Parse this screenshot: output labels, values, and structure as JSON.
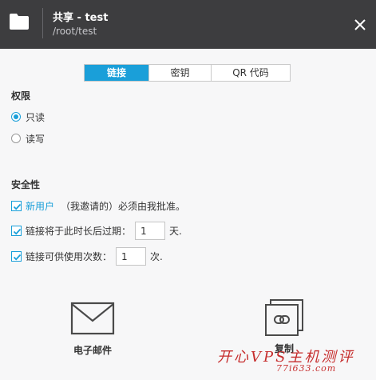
{
  "window": {
    "title": "共享 - test",
    "path": "/root/test",
    "folder_icon": "folder-icon",
    "close_icon": "close-icon"
  },
  "tabs": [
    {
      "label": "链接",
      "active": true
    },
    {
      "label": "密钥",
      "active": false
    },
    {
      "label": "QR 代码",
      "active": false
    }
  ],
  "permissions": {
    "heading": "权限",
    "options": [
      {
        "label": "只读",
        "checked": true
      },
      {
        "label": "读写",
        "checked": false
      }
    ]
  },
  "security": {
    "heading": "安全性",
    "new_user": {
      "link": "新用户",
      "text": "（我邀请的）必须由我批准。",
      "checked": true
    },
    "expire": {
      "text": "链接将于此时长后过期：",
      "value": "1",
      "unit": "天.",
      "checked": true
    },
    "uses": {
      "text": "链接可供使用次数：",
      "value": "1",
      "unit": "次.",
      "checked": true
    }
  },
  "actions": {
    "email": {
      "label": "电子邮件",
      "icon": "envelope-icon"
    },
    "copy": {
      "label": "复制",
      "icon": "copy-link-icon"
    }
  },
  "watermark": {
    "main": "开心VPS主机测评",
    "sub": "77i633.com"
  },
  "colors": {
    "accent": "#1a9fd9",
    "titlebar": "#3d3d3f",
    "background": "#f7f7f8"
  }
}
